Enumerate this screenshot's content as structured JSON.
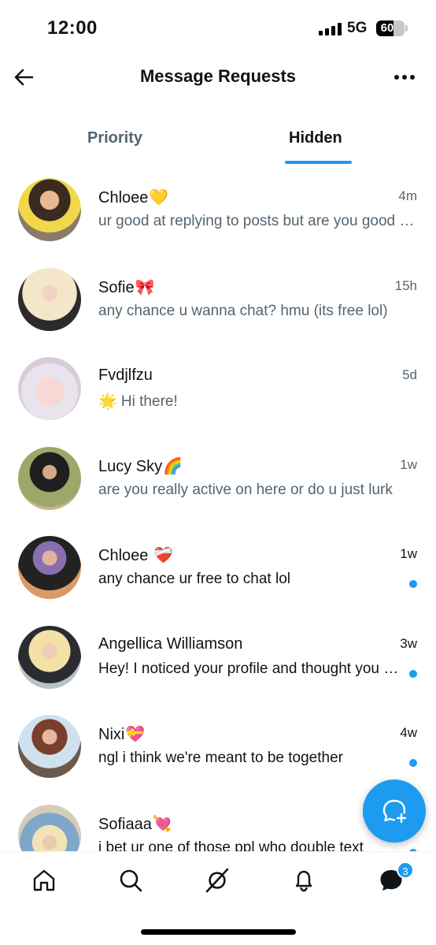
{
  "status_bar": {
    "time": "12:00",
    "network": "5G",
    "battery": "60"
  },
  "header": {
    "title": "Message Requests",
    "back_icon": "arrow-left-icon",
    "more_icon": "more-horizontal-icon"
  },
  "tabs": [
    {
      "label": "Priority",
      "active": false
    },
    {
      "label": "Hidden",
      "active": true
    }
  ],
  "conversations": [
    {
      "name": "Chloee",
      "emoji": "💛",
      "time": "4m",
      "preview": "ur good at replying to posts but are you good at replying to messages",
      "unread": false
    },
    {
      "name": "Sofie",
      "emoji": "🎀",
      "time": "15h",
      "preview": "any chance u wanna chat? hmu (its free lol)",
      "unread": false
    },
    {
      "name": "Fvdjlfzu",
      "emoji": "",
      "time": "5d",
      "preview": "🌟 Hi there!",
      "unread": false
    },
    {
      "name": "Lucy Sky",
      "emoji": "🌈",
      "time": "1w",
      "preview": "are you really active on here or do u just lurk",
      "unread": false
    },
    {
      "name": "Chloee ",
      "emoji": "❤️‍🩹",
      "time": "1w",
      "preview": "any chance ur free to chat lol",
      "unread": true
    },
    {
      "name": "Angellica Williamson",
      "emoji": "",
      "time": "3w",
      "preview": "Hey! I noticed your profile and thought you seemed interesting",
      "unread": true
    },
    {
      "name": "Nixi",
      "emoji": "💝",
      "time": "4w",
      "preview": "ngl i think we're meant to be together",
      "unread": true
    },
    {
      "name": "Sofiaaa",
      "emoji": "💘",
      "time": "",
      "preview": "i bet ur one of those ppl who double text",
      "unread": true
    }
  ],
  "fab": {
    "icon": "new-message-icon"
  },
  "bottom_nav": {
    "items": [
      "home-icon",
      "search-icon",
      "grok-icon",
      "notifications-icon",
      "messages-icon"
    ],
    "messages_badge": "3"
  },
  "colors": {
    "accent": "#1d9bf0",
    "text": "#0f1419",
    "secondary": "#536471"
  }
}
